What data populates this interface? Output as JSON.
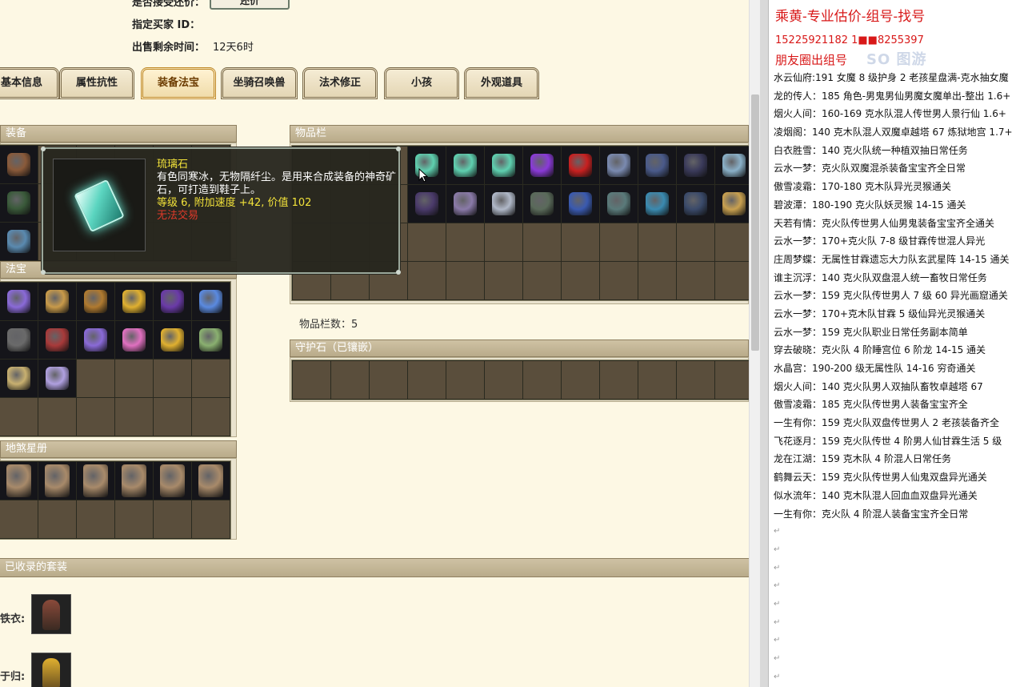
{
  "page": {
    "top_fields": [
      {
        "label": "是否接受还价：",
        "value": ""
      },
      {
        "label": "指定买家 ID：",
        "value": ""
      },
      {
        "label": "出售剩余时间：",
        "value": "12天6时"
      }
    ],
    "confirm_label": "还价",
    "tabs": [
      "基本信息",
      "属性抗性",
      "装备法宝",
      "坐骑召唤兽",
      "法术修正",
      "小孩",
      "外观道具"
    ],
    "active_tab": 2,
    "sections": {
      "equipment": "装备",
      "fabao": "法宝",
      "dishaxingce": "地煞星册",
      "inventory": "物品栏",
      "guardian": "守护石（已镶嵌）",
      "suits": "已收录的套装"
    },
    "inventory_count_label": "物品栏数：5",
    "tooltip": {
      "name": "琉璃石",
      "desc": "有色同寒冰，无物隔纤尘。是用来合成装备的神奇矿石，可打造到鞋子上。",
      "stat": "等级 6, 附加速度 +42, 价值 102",
      "trade": "无法交易"
    },
    "suits": [
      {
        "label": "铁衣:"
      },
      {
        "label": "于归:"
      }
    ],
    "icon_colors": {
      "equip": [
        "#8a5a3a",
        "#3a5a3a",
        "#5a8ab0"
      ],
      "inventory": [
        "#5fd0b0",
        "#5fd0b0",
        "#5fd0b0",
        "#8a3ad8",
        "#c82020",
        "#7a8ab0",
        "#4a5a8a",
        "#3a3a5a",
        "#8ab0c8",
        "#4a3a6a",
        "#8a7aa8",
        "#b0b8c8",
        "#5a6a5a",
        "#3a5ab0",
        "#5a7a7a",
        "#3a8ab0",
        "#3a4a6a",
        "#c8a050"
      ],
      "fabao": [
        "#8a6ad8",
        "#c89a4a",
        "#b07a30",
        "#e0b030",
        "#6a3aa8",
        "#5a8ae0",
        "#6a6a6a",
        "#a83a3a",
        "#8a6ad8",
        "#e070c0",
        "#e0b030",
        "#8ab070",
        "#c8b070",
        "#b0a0e0"
      ]
    }
  },
  "notes": {
    "title": "乘黄-专业估价-组号-找号",
    "phones": "15225921182   1■■8255397",
    "circle": "朋友圈出组号",
    "watermark": "SO 图游",
    "lines": [
      "水云仙府:191 女魔 8 级护身 2 老孩星盘满-克水抽女魔",
      "龙的传人：185 角色-男鬼男仙男魔女魔单出-整出 1.6+",
      "烟火人间：160-169 克水队混人传世男人景行仙 1.6+",
      "凌烟阁：140 克木队混人双魔卓越塔 67 炼狱地宫 1.7+",
      "白衣胜雪：140 克火队统一种植双抽日常任务",
      "云水一梦：克火队双魔混杀装备宝宝齐全日常",
      "傲雪凌霜：170-180 克木队异光灵猴通关",
      "碧波潭：180-190 克火队妖灵猴 14-15 通关",
      "天若有情：克火队传世男人仙男鬼装备宝宝齐全通关",
      "云水一梦：170+克火队 7-8 级甘霖传世混人异光",
      "庄周梦蝶：无属性甘霖遗忘大力队玄武星阵 14-15 通关",
      "谁主沉浮：140 克火队双盘混人统一畜牧日常任务",
      "云水一梦：159 克火队传世男人 7 级 60 异光画窟通关",
      "云水一梦：170+克木队甘霖 5 级仙异光灵猴通关",
      "云水一梦：159 克火队职业日常任务副本简单",
      "穿去破晓：克火队 4 阶睡宫位 6 阶龙 14-15 通关",
      "水晶宫：190-200 级无属性队 14-16 穷奇通关",
      "烟火人间：140 克火队男人双抽队畜牧卓越塔 67",
      "傲雪凌霜：185 克火队传世男人装备宝宝齐全",
      "一生有你：159 克火队双盘传世男人 2 老孩装备齐全",
      "飞花逐月：159 克火队传世 4 阶男人仙甘霖生活 5 级",
      "龙在江湖：159 克木队 4 阶混人日常任务",
      "鹤舞云天：159 克火队传世男人仙鬼双盘异光通关",
      "似水流年：140 克木队混人回血血双盘异光通关",
      "一生有你：克火队 4 阶混人装备宝宝齐全日常"
    ],
    "blank_mark": "↵"
  }
}
